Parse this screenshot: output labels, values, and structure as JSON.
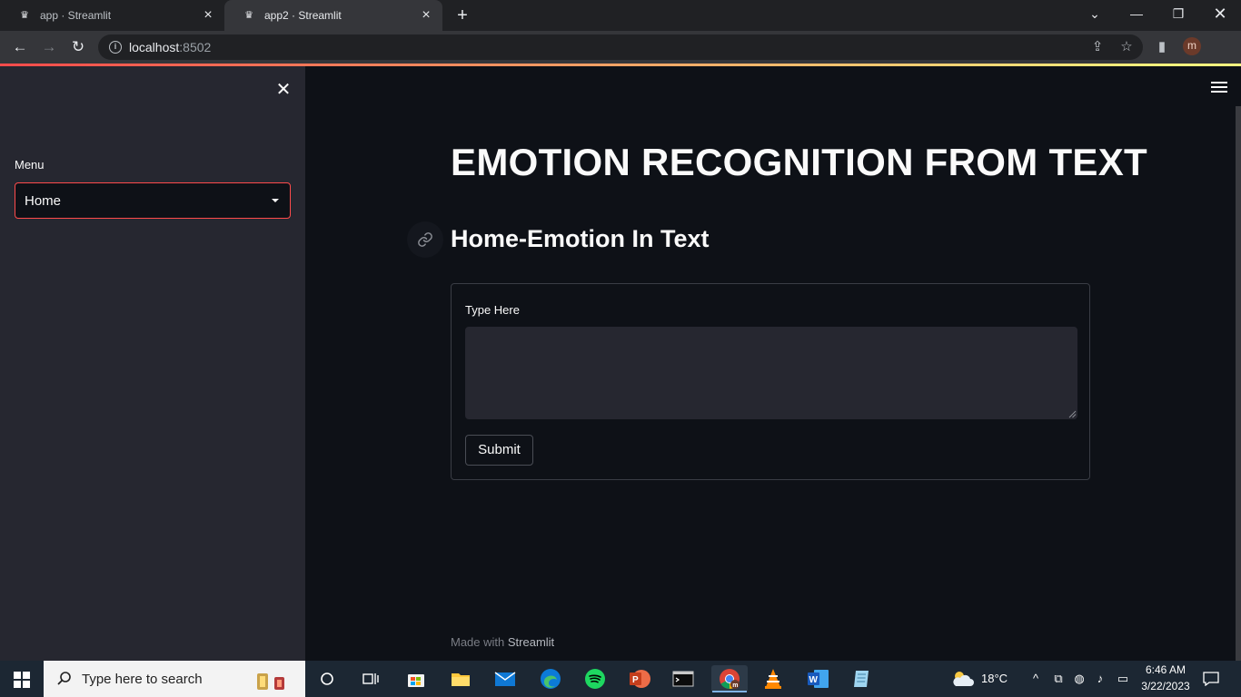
{
  "browser": {
    "tabs": [
      {
        "title": "app · Streamlit",
        "active": false
      },
      {
        "title": "app2 · Streamlit",
        "active": true
      }
    ],
    "url_host": "localhost",
    "url_port": ":8502",
    "profile_initial": "m"
  },
  "sidebar": {
    "menu_label": "Menu",
    "select_value": "Home"
  },
  "main": {
    "title": "EMOTION RECOGNITION FROM TEXT",
    "subheader": "Home-Emotion In Text",
    "form": {
      "textarea_label": "Type Here",
      "textarea_value": "",
      "submit_label": "Submit"
    },
    "footer_prefix": "Made with ",
    "footer_brand": "Streamlit"
  },
  "taskbar": {
    "search_placeholder": "Type here to search",
    "weather": "18°C",
    "time": "6:46 AM",
    "date": "3/22/2023",
    "apps": [
      "cortana-icon",
      "task-view-icon",
      "microsoft-store-icon",
      "file-explorer-icon",
      "mail-icon",
      "edge-icon",
      "spotify-icon",
      "powerpoint-icon",
      "terminal-icon",
      "chrome-icon",
      "vlc-icon",
      "word-icon",
      "notepad-icon"
    ]
  },
  "colors": {
    "accent": "#ff4b4b",
    "background": "#0e1117",
    "sidebar": "#262730"
  }
}
